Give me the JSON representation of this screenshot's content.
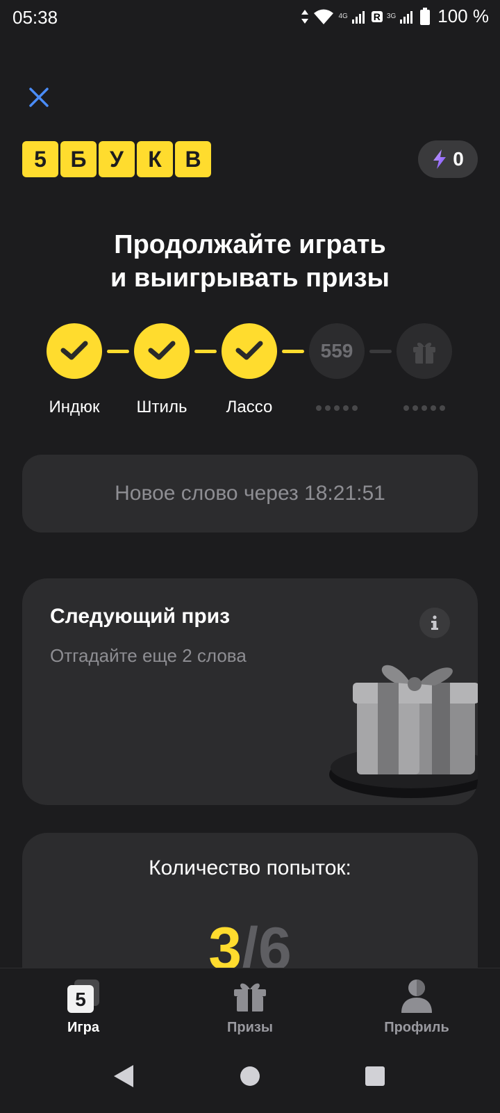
{
  "status_bar": {
    "time": "05:38",
    "net1": "4G",
    "roaming": "R",
    "net2": "3G",
    "battery": "100 %"
  },
  "header": {
    "close_icon": "close-icon",
    "logo_letters": [
      "5",
      "Б",
      "У",
      "К",
      "В"
    ],
    "energy_count": "0"
  },
  "headline": {
    "line1": "Продолжайте играть",
    "line2": "и выигрывать призы"
  },
  "progress": {
    "steps": [
      {
        "label": "Индюк",
        "state": "done"
      },
      {
        "label": "Штиль",
        "state": "done"
      },
      {
        "label": "Лассо",
        "state": "done"
      },
      {
        "label": "",
        "state": "locked",
        "number": "559"
      },
      {
        "label": "",
        "state": "gift"
      }
    ]
  },
  "timer": {
    "text": "Новое слово через 18:21:51"
  },
  "prize_card": {
    "title": "Следующий приз",
    "subtitle": "Отгадайте еще 2 слова"
  },
  "attempts": {
    "label": "Количество попыток:",
    "used": "3",
    "separator": "/",
    "total": "6"
  },
  "bottom_nav": {
    "items": [
      {
        "label": "Игра",
        "icon": "game-icon",
        "active": true
      },
      {
        "label": "Призы",
        "icon": "gift-icon",
        "active": false
      },
      {
        "label": "Профиль",
        "icon": "profile-icon",
        "active": false
      }
    ]
  },
  "colors": {
    "background": "#1c1c1e",
    "card": "#2c2c2e",
    "accent_yellow": "#ffdc2e",
    "close_blue": "#4a8cf7",
    "muted_text": "#8e8e93"
  }
}
